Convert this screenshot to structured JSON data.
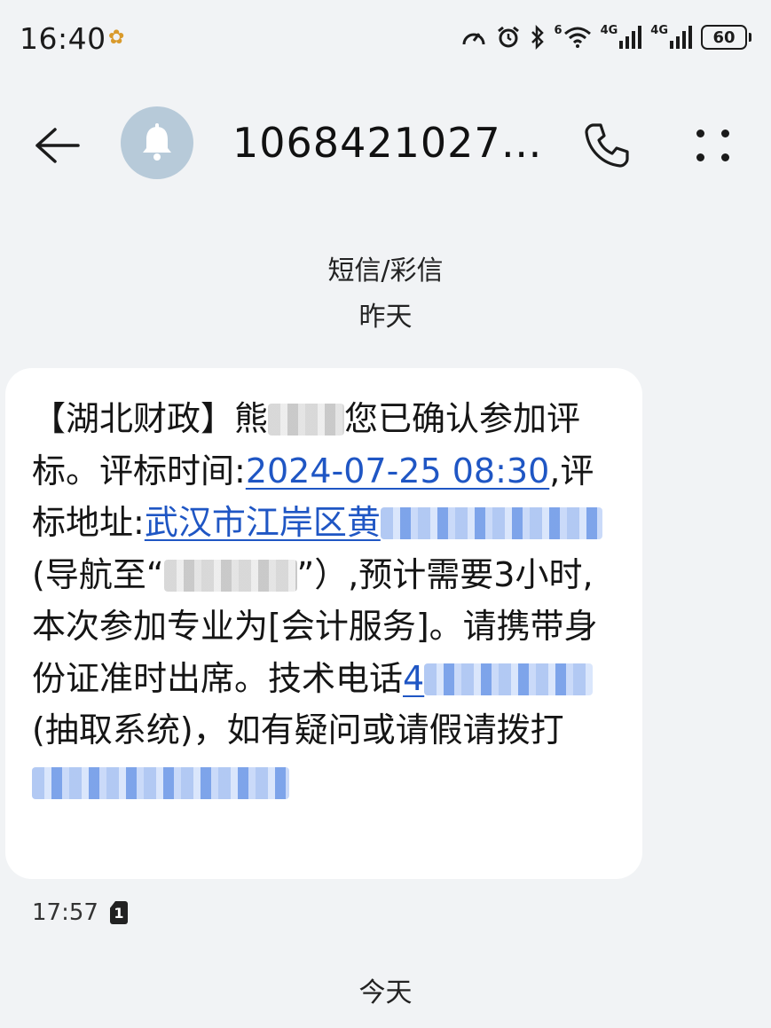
{
  "status_bar": {
    "time": "16:40",
    "network_labels": [
      "4G",
      "4G"
    ],
    "wifi_label": "6",
    "battery": "60"
  },
  "header": {
    "sender": "1068421027…",
    "avatar_icon": "bell-icon",
    "back_icon": "arrow-left-icon",
    "call_icon": "phone-icon",
    "more_icon": "more-dots-icon"
  },
  "conversation": {
    "message_type": "短信/彩信",
    "day_label_1": "昨天",
    "day_label_2": "今天"
  },
  "message": {
    "part1": "【湖北财政】熊",
    "part2": "您已确认参加评标。评标时间:",
    "datetime": "2024-07-25 08:30",
    "part3": ",评标地址:",
    "address_start": "武汉市江岸区黄",
    "part4": "(导航至“",
    "part5": "”）,预计需要3小时,本次参加专业为[会计服务]。请携带身份证准时出席。技术电话",
    "phone_start": "4",
    "part6": "(抽取系统)，如有疑问或请假请拨打",
    "sent_time": "17:57",
    "sim_badge": "1"
  },
  "colors": {
    "background": "#f1f3f5",
    "bubble": "#ffffff",
    "link": "#1f56c4",
    "avatar": "#b7cad9"
  }
}
